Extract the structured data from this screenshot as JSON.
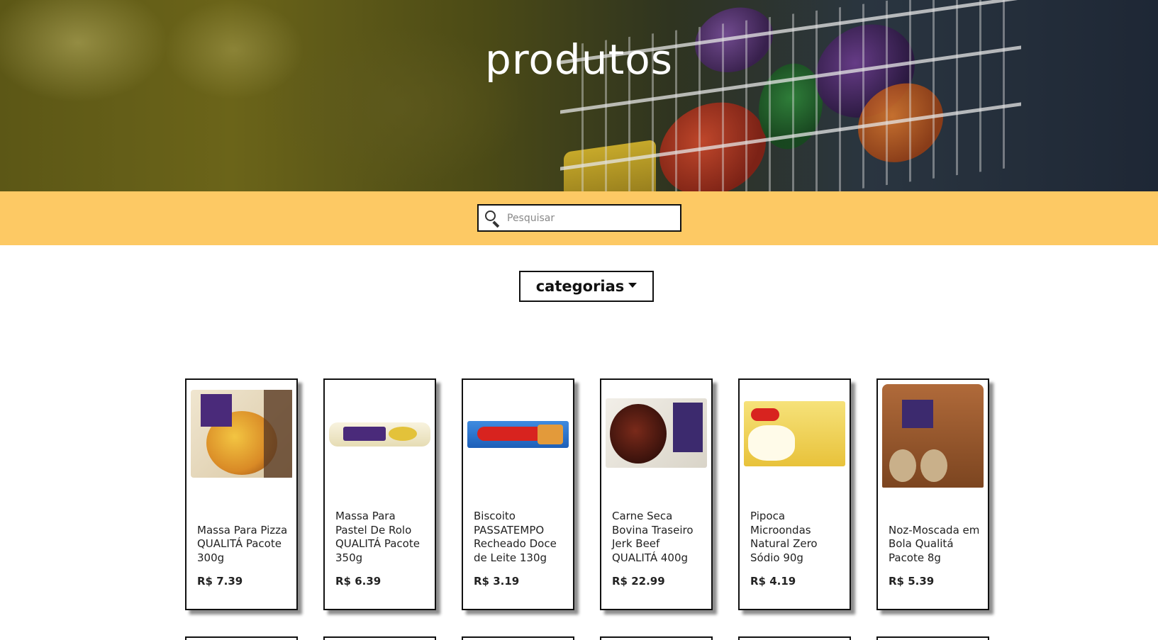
{
  "hero": {
    "title": "produtos"
  },
  "search": {
    "placeholder": "Pesquisar",
    "icon": "search-icon"
  },
  "categories": {
    "label": "categorias",
    "icon": "caret-down-icon"
  },
  "colors": {
    "search_band": "#fdc964",
    "border": "#111111"
  },
  "products": [
    {
      "name": "Massa Para Pizza QUALITÁ Pacote 300g",
      "price": "R$ 7.39"
    },
    {
      "name": "Massa Para Pastel De Rolo QUALITÁ Pacote 350g",
      "price": "R$ 6.39"
    },
    {
      "name": "Biscoito PASSATEMPO Recheado Doce de Leite 130g",
      "price": "R$ 3.19"
    },
    {
      "name": "Carne Seca Bovina Traseiro Jerk Beef QUALITÁ 400g",
      "price": "R$ 22.99"
    },
    {
      "name": "Pipoca Microondas Natural Zero Sódio 90g",
      "price": "R$ 4.19"
    },
    {
      "name": "Noz-Moscada em Bola Qualitá Pacote 8g",
      "price": "R$ 5.39"
    }
  ]
}
